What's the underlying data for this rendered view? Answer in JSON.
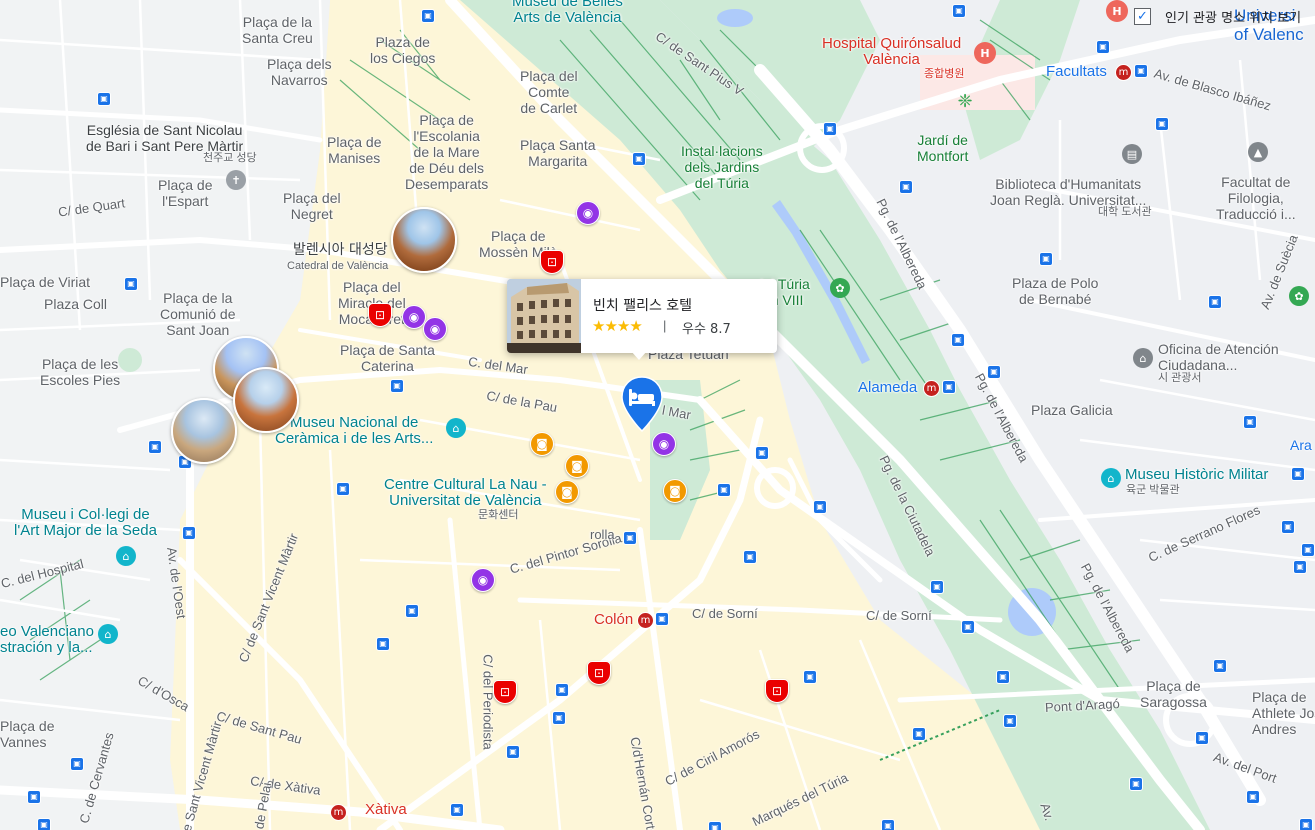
{
  "map": {
    "toggle": {
      "label": "인기 관광 명소 위치 보기",
      "checked": true
    },
    "hotel_card": {
      "name": "빈치 팰리스 호텔",
      "stars": "★★★★",
      "separator": "|",
      "rating_text": "우수 8.7"
    },
    "labels": {
      "placa_la_santa_creu": "Plaça de la\nSanta Creu",
      "plaza_los_ciegos": "Plaza de\nlos Ciegos",
      "placa_navarros": "Plaça dels\nNavarros",
      "placa_comte_carlet": "Plaça del\nComte\nde Carlet",
      "esglesia_sant_nicolau": "Església de Sant Nicolau\nde Bari i Sant Pere Màrtir",
      "esglesia_ko": "천주교 성당",
      "placa_manises": "Plaça de\nManises",
      "placa_escolania": "Plaça de\nl'Escolania\nde la Mare\nde Déu dels\nDesemparats",
      "placa_santa_margarita": "Plaça Santa\nMargarita",
      "placa_espart": "Plaça de\nl'Espart",
      "placa_negret": "Plaça del\nNegret",
      "c_quart": "C/ de Quart",
      "catedral_ko": "발렌시아 대성당",
      "catedral_sub": "Catedral de València",
      "placa_mossen_milla": "Plaça de\nMossèn Milà",
      "placa_viriat": "Plaça de Viriat",
      "plaza_coll": "Plaza Coll",
      "placa_comunio": "Plaça de la\nComunió de\nSant Joan",
      "placa_miracle": "Plaça del\nMiracle del\nMocadoret",
      "placa_santa_caterina": "Plaça de Santa\nCaterina",
      "placa_escoles_pies": "Plaça de les\nEscoles Pies",
      "c_del_mar": "C. del Mar",
      "c_de_la_pau": "C/ de la Pau",
      "plaza_tetuan": "Plaza Tetuán",
      "c_mar2": "l Mar",
      "museu_ceramica": "Museu Nacional de\nCeràmica i de les Arts...",
      "centre_nau": "Centre Cultural La Nau -\nUniversitat de València",
      "centre_nau_ko": "문화센터",
      "museu_seda": "Museu i Col·legi de\nl'Art Major de la Seda",
      "c_hospital": "C. del Hospital",
      "av_oest": "Av. de l'Oest",
      "c_sant_vicent": "C/ de Sant Vicent Màrtir",
      "c_pintor_sorolla": "C. del Pintor Sorolla",
      "museo_valenciano": "eo Valenciano\nstración y la...",
      "c_docsa": "C/ d'Osca",
      "c_sant_pau": "C/ de Sant Pau",
      "placa_vannes": "Plaça de\nVannes",
      "c_cervantes": "C. de Cervantes",
      "c_xativa": "C/ de Xàtiva",
      "xativa_station": "Xàtiva",
      "c_pelai": "C/ de Pelai",
      "c_del_periodista": "C/ del Periodista",
      "c_hernan_cortes": "C/d'Hernán Cortés",
      "c_ciril_amoros": "C/ de Ciril Amorós",
      "c_sorni": "C/ de Sorní",
      "c_sorni2": "C/ de Sorní",
      "c_sorolla_short": "rolla",
      "colon": "Colón",
      "marques_turia": "Marqués del Túria",
      "museu_belles_arts": "Museu de Belles\nArts de València",
      "c_sant_pius": "C/ de Sant Pius V",
      "hospital_quiron": "Hospital Quirónsalud\nValència",
      "hospital_ko": "종합병원",
      "univ": "Universi\nof Valenc",
      "facultats": "Facultats",
      "av_blasco": "Av. de Blasco Ibáñez",
      "installacions_turia": "Instal·lacions\ndels Jardins\ndel Túria",
      "jardi_montfort": "Jardí de\nMontfort",
      "biblioteca": "Biblioteca d'Humanitats\nJoan Reglà. Universitat...",
      "biblioteca_ko": "대학 도서관",
      "facultat_filologia": "Facultat de\nFilologia,\nTraducció i...",
      "pg_alberda1": "Pg. de l'Albereda",
      "parc_turia": "rc del Túria\nTram VIII",
      "plaza_polo": "Plaza de Polo\nde Bernabé",
      "av_suecia": "Av. de Suècia",
      "oficina_atencion": "Oficina de Atención\nCiudadana...",
      "oficina_ko": "시 관광서",
      "alameda": "Alameda",
      "pg_alberda2": "Pg. de l'Albereda",
      "plaza_galicia": "Plaza Galicia",
      "ara": "Ara",
      "museu_militar": "Museu Històric Militar",
      "museu_militar_ko": "육군 박물관",
      "pg_ciutadela": "Pg. de la Ciutadela",
      "c_serrano_flores": "C. de Serrano Flores",
      "pg_alberda3": "Pg. de l'Albereda",
      "placa_saragossa": "Plaça de\nSaragossa",
      "pont_arago": "Pont d'Aragó",
      "placa_athlete": "Plaça de\nAthlete Jos\nAndres",
      "av_del_port": "Av. del Port",
      "av_bottom": "Av."
    }
  }
}
